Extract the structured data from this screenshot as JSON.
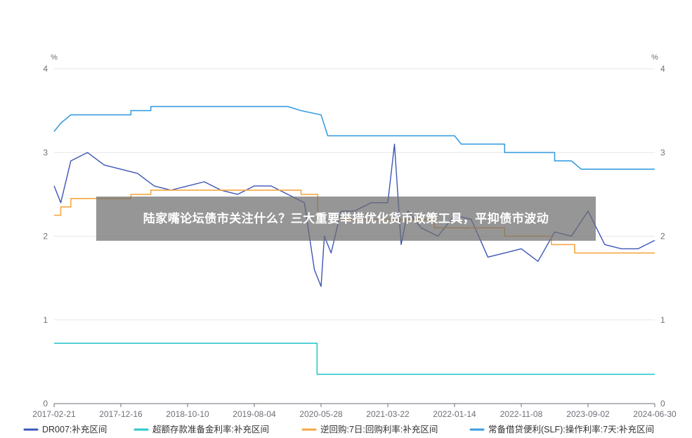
{
  "overlay_title": "陆家嘴论坛债市关注什么？三大重要举措优化货币政策工具，平抑债市波动",
  "chart_data": {
    "type": "line",
    "title": "",
    "y_unit_left": "%",
    "y_unit_right": "%",
    "ylim": [
      0,
      4
    ],
    "y_ticks": [
      "0",
      "1",
      "2",
      "3",
      "4"
    ],
    "x_tick_labels": [
      "2017-02-21",
      "2017-12-16",
      "2018-10-10",
      "2019-08-04",
      "2020-05-28",
      "2021-03-22",
      "2022-01-14",
      "2022-11-08",
      "2023-09-02",
      "2024-06-30"
    ],
    "grid": true,
    "legend_position": "bottom",
    "series": [
      {
        "name": "DR007:补充区间",
        "color": "#3d55b8",
        "x": [
          0,
          0.1,
          0.25,
          0.5,
          0.75,
          1.0,
          1.25,
          1.5,
          1.75,
          2.0,
          2.25,
          2.5,
          2.75,
          3.0,
          3.25,
          3.5,
          3.75,
          3.9,
          4.0,
          4.05,
          4.15,
          4.3,
          4.5,
          4.75,
          5.0,
          5.1,
          5.2,
          5.3,
          5.5,
          5.75,
          6.0,
          6.25,
          6.5,
          6.75,
          7.0,
          7.25,
          7.5,
          7.75,
          8.0,
          8.25,
          8.5,
          8.75,
          9.0
        ],
        "values": [
          2.6,
          2.4,
          2.9,
          3.0,
          2.85,
          2.8,
          2.75,
          2.6,
          2.55,
          2.6,
          2.65,
          2.55,
          2.5,
          2.6,
          2.6,
          2.5,
          2.4,
          1.6,
          1.4,
          2.0,
          1.8,
          2.3,
          2.3,
          2.4,
          2.4,
          3.1,
          1.9,
          2.3,
          2.1,
          2.0,
          2.25,
          2.2,
          1.75,
          1.8,
          1.85,
          1.7,
          2.05,
          2.0,
          2.3,
          1.9,
          1.85,
          1.85,
          1.95
        ]
      },
      {
        "name": "超额存款准备金利率:补充区间",
        "color": "#2ec7c9",
        "x": [
          0,
          3.94,
          3.94,
          9.0
        ],
        "values": [
          0.72,
          0.72,
          0.35,
          0.35
        ]
      },
      {
        "name": "逆回购:7日:回购利率:补充区间",
        "color": "#f5a742",
        "x": [
          0,
          0.1,
          0.1,
          0.25,
          0.25,
          1.15,
          1.15,
          1.45,
          1.45,
          3.7,
          3.7,
          3.95,
          3.95,
          5.7,
          5.7,
          6.75,
          6.75,
          7.45,
          7.45,
          7.8,
          7.8,
          8.0,
          8.0,
          9.0
        ],
        "values": [
          2.25,
          2.25,
          2.35,
          2.35,
          2.45,
          2.45,
          2.5,
          2.5,
          2.55,
          2.55,
          2.5,
          2.5,
          2.2,
          2.2,
          2.1,
          2.1,
          2.0,
          2.0,
          1.9,
          1.9,
          1.8,
          1.8,
          1.8,
          1.8
        ]
      },
      {
        "name": "常备借贷便利(SLF):操作利率:7天:补充区间",
        "color": "#3a9ee0",
        "x": [
          0,
          0.1,
          0.25,
          1.15,
          1.15,
          1.45,
          1.45,
          3.5,
          3.7,
          3.7,
          4.0,
          4.1,
          5.0,
          6.0,
          6.1,
          6.75,
          6.75,
          7.5,
          7.5,
          7.75,
          7.9,
          9.0
        ],
        "values": [
          3.25,
          3.35,
          3.45,
          3.45,
          3.5,
          3.5,
          3.55,
          3.55,
          3.5,
          3.5,
          3.45,
          3.2,
          3.2,
          3.2,
          3.1,
          3.1,
          3.0,
          3.0,
          2.9,
          2.9,
          2.8,
          2.8
        ]
      }
    ]
  }
}
